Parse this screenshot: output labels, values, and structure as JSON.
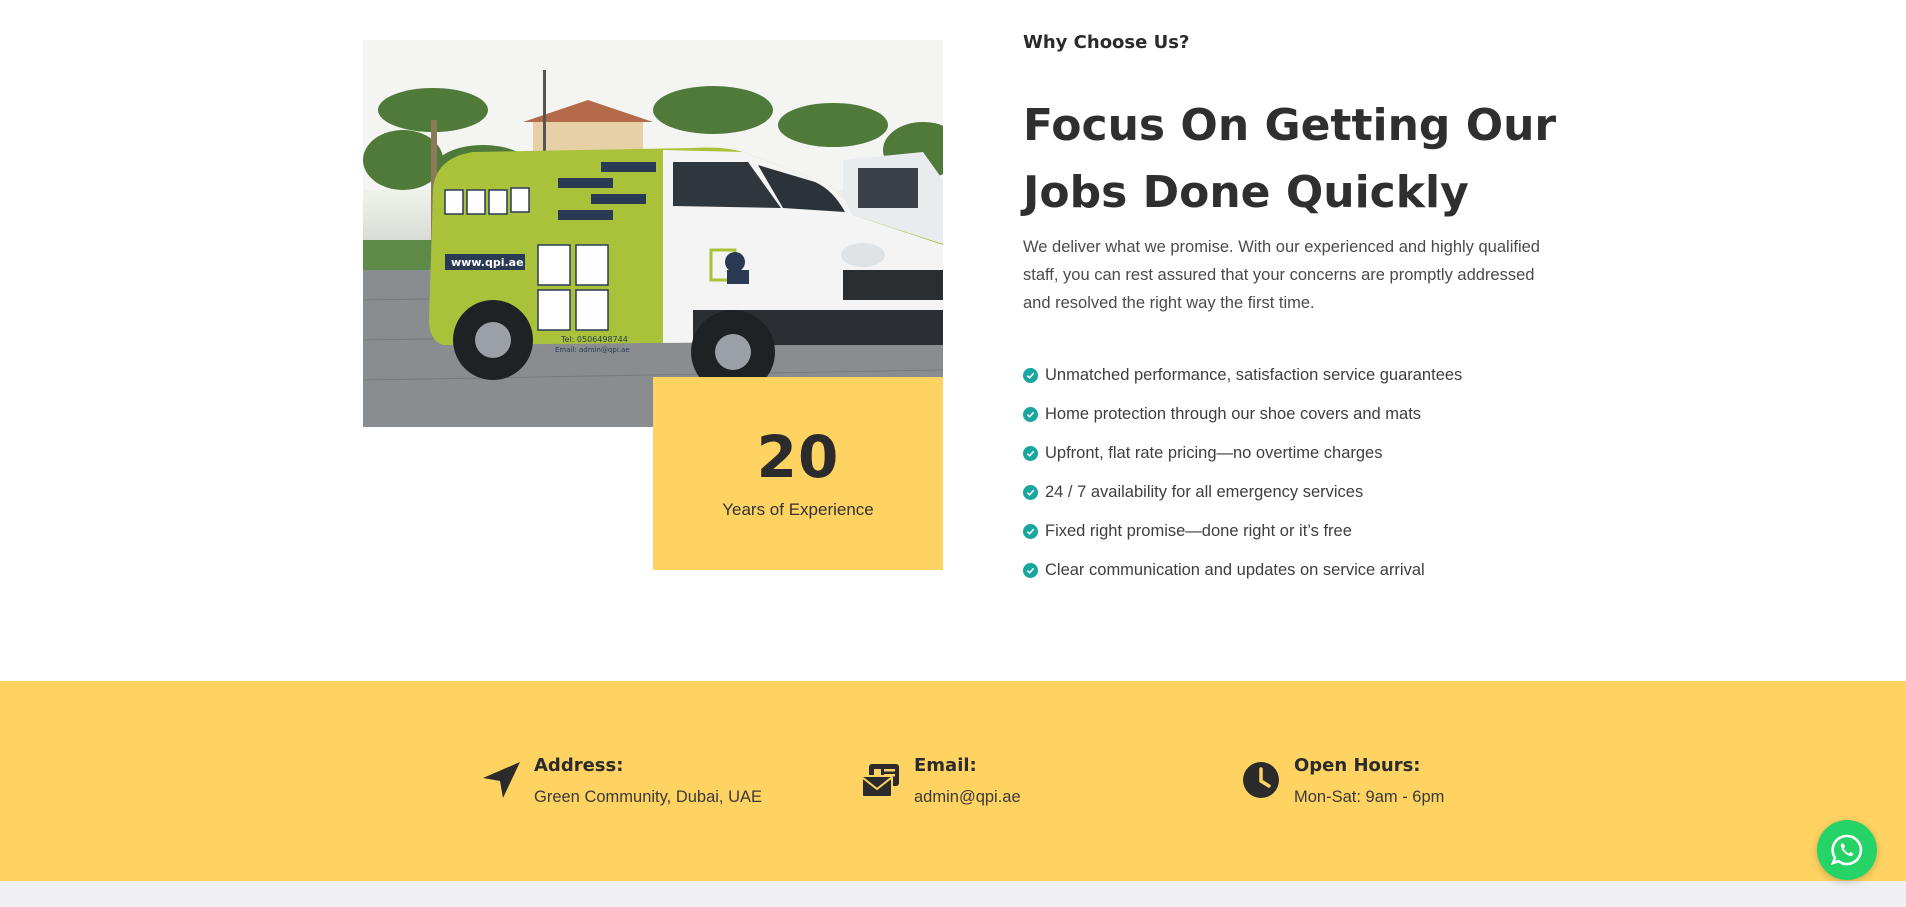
{
  "about": {
    "eyebrow": "Why Choose Us?",
    "heading": "Focus On Getting Our Jobs Done Quickly",
    "intro": "We deliver what we promise. With our experienced and highly qualified staff, you can rest assured that your concerns are promptly addressed and resolved the right way the first time.",
    "experience": {
      "number": "20",
      "label": "Years of Experience"
    },
    "van_text": {
      "website": "www.qpi.ae",
      "phone": "Tel: 0506498744",
      "email": "Email: admin@qpi.ae"
    },
    "features": [
      "Unmatched performance, satisfaction service guarantees",
      "Home protection through our shoe covers and mats",
      "Upfront, flat rate pricing—no overtime charges",
      "24 / 7 availability for all emergency services",
      "Fixed right promise—done right or it’s free",
      "Clear communication and updates on service arrival"
    ]
  },
  "contact": {
    "address": {
      "title": "Address:",
      "value": "Green Community, Dubai, UAE",
      "icon": "location-arrow-icon"
    },
    "email": {
      "title": "Email:",
      "value": "admin@qpi.ae",
      "icon": "envelope-card-icon"
    },
    "hours": {
      "title": "Open Hours:",
      "value": "Mon-Sat: 9am - 6pm",
      "icon": "clock-icon"
    }
  },
  "colors": {
    "accent_yellow": "#ffd362",
    "check_teal": "#19a5a0",
    "whatsapp_green": "#25d366",
    "van_green": "#a9c23a"
  },
  "whatsapp": {
    "icon": "whatsapp-icon"
  }
}
